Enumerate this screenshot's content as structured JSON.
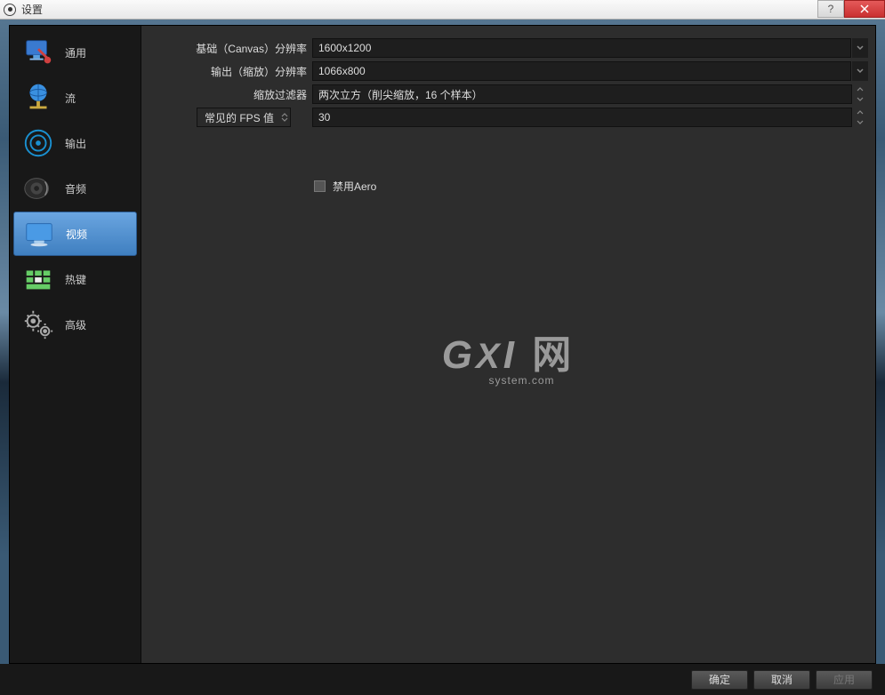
{
  "window": {
    "title": "设置"
  },
  "sidebar": {
    "items": [
      {
        "label": "通用"
      },
      {
        "label": "流"
      },
      {
        "label": "输出"
      },
      {
        "label": "音频"
      },
      {
        "label": "视频"
      },
      {
        "label": "热键"
      },
      {
        "label": "高级"
      }
    ]
  },
  "video": {
    "base_label": "基础（Canvas）分辨率",
    "base_value": "1600x1200",
    "output_label": "输出（缩放）分辨率",
    "output_value": "1066x800",
    "filter_label": "缩放过滤器",
    "filter_value": "两次立方（削尖缩放，16 个样本）",
    "fps_label": "常见的 FPS 值",
    "fps_value": "30",
    "disable_aero_label": "禁用Aero"
  },
  "watermark": {
    "line1": "GXI网",
    "line2": "system.com"
  },
  "footer": {
    "ok": "确定",
    "cancel": "取消",
    "apply": "应用"
  }
}
